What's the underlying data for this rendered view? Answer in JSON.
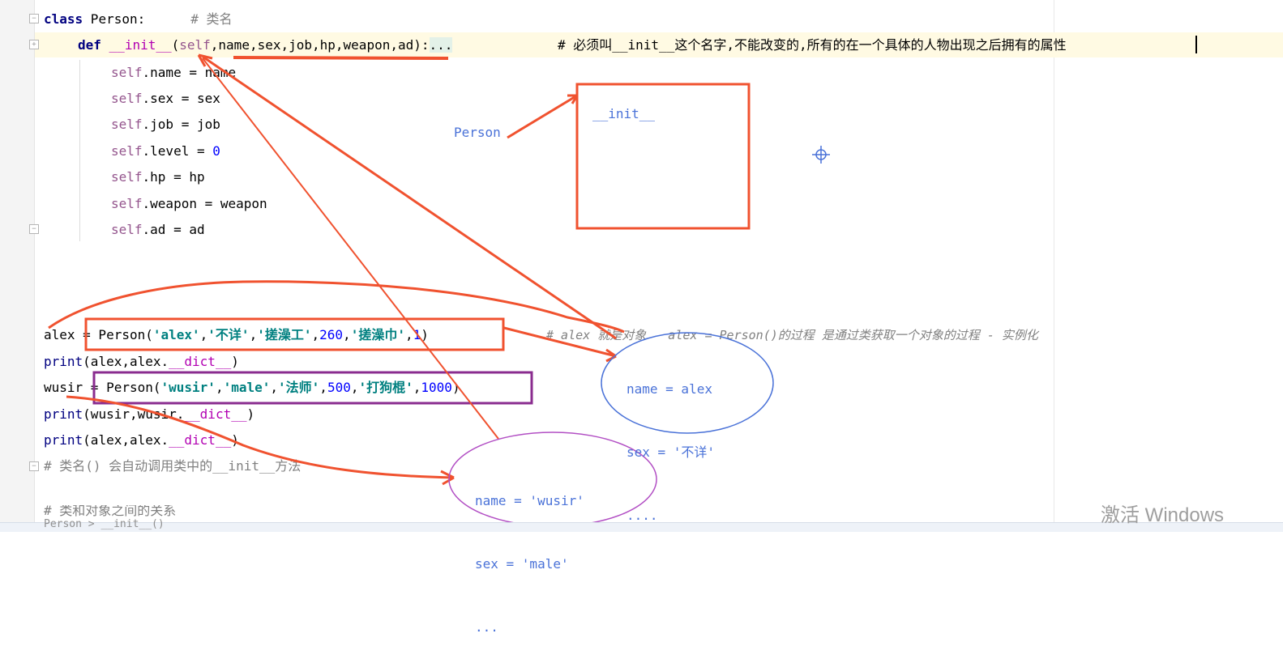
{
  "code": {
    "class_kw": "class",
    "class_name": " Person:",
    "class_comment": "# 类名",
    "def_kw": "def",
    "init_name": "__init__",
    "init_params_open": "(",
    "init_self": "self",
    "init_params": ",name,sex,job,hp,weapon,ad):",
    "init_fold": "...",
    "init_comment": "# 必须叫__init__这个名字,不能改变的,所有的在一个具体的人物出现之后拥有的属性",
    "body": [
      {
        "self": "self",
        "rest": ".name = name"
      },
      {
        "self": "self",
        "rest": ".sex = sex"
      },
      {
        "self": "self",
        "rest": ".job = job"
      },
      {
        "self": "self",
        "rest": ".level = ",
        "num": "0"
      },
      {
        "self": "self",
        "rest": ".hp = hp"
      },
      {
        "self": "self",
        "rest": ".weapon = weapon"
      },
      {
        "self": "self",
        "rest": ".ad = ad"
      }
    ],
    "alex_line": {
      "lhs": "alex = Person(",
      "s1": "'alex'",
      "s2": "'不详'",
      "s3": "'搓澡工'",
      "n1": "260",
      "s4": "'搓澡巾'",
      "n2": "1",
      "comment": "# alex 就是对象   alex = Person()的过程 是通过类获取一个对象的过程 - 实例化"
    },
    "print_alex": {
      "fn": "print",
      "args": "(alex,alex.",
      "dunder": "__dict__",
      "close": ")"
    },
    "wusir_line": {
      "lhs": "wusir = Person(",
      "s1": "'wusir'",
      "s2": "'male'",
      "s3": "'法师'",
      "n1": "500",
      "s4": "'打狗棍'",
      "n2": "1000"
    },
    "print_wusir": {
      "fn": "print",
      "args": "(wusir,wusir.",
      "dunder": "__dict__",
      "close": ")"
    },
    "print_alex2": {
      "fn": "print",
      "args": "(alex,alex.",
      "dunder": "__dict__",
      "close": ")"
    },
    "last_comment": "# 类名() 会自动调用类中的__init__方法",
    "cut_comment": "# 类和对象之间的关系",
    "bottom_text": "Person > __init__()"
  },
  "annotations": {
    "person_label": "Person",
    "init_box_label": "__init__",
    "alex_attrs": [
      "name = alex",
      "sex = '不详'",
      "...."
    ],
    "wusir_attrs": [
      "name = 'wusir'",
      "sex = 'male'",
      "..."
    ]
  },
  "watermark": "激活 Windows",
  "colors": {
    "ink_red": "#f0522f",
    "ink_purple": "#8a2c8f",
    "ink_blue": "#4a72d8",
    "ellipse_purple": "#b24fc4"
  }
}
